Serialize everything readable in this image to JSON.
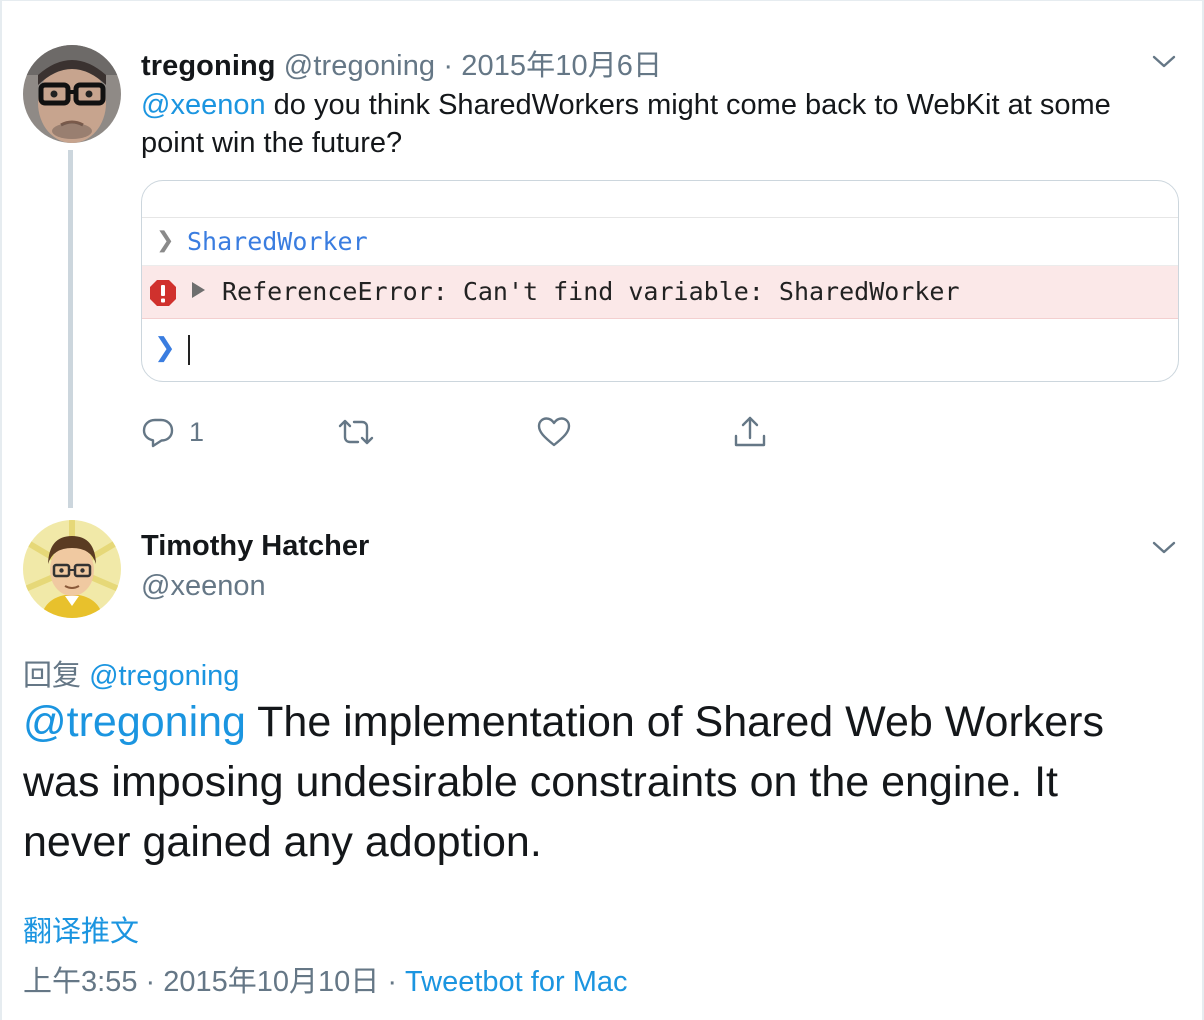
{
  "parent_tweet": {
    "display_name": "tregoning",
    "handle": "@tregoning",
    "separator": " · ",
    "date": "2015年10月6日",
    "mention": "@xeenon",
    "text": " do you think SharedWorkers might come back to WebKit at some point win the future?",
    "console": {
      "input_line": "SharedWorker",
      "error_line": "ReferenceError: Can't find variable: SharedWorker"
    },
    "reply_count": "1"
  },
  "main_tweet": {
    "display_name": "Timothy Hatcher",
    "handle": "@xeenon",
    "replying_prefix": "回复 ",
    "replying_to": "@tregoning",
    "mention": "@tregoning",
    "text": " The implementation of Shared Web Workers was imposing undesirable constraints on the engine. It never gained any adoption.",
    "translate_label": "翻译推文",
    "time": "上午3:55",
    "separator1": " · ",
    "date": "2015年10月10日",
    "separator2": " · ",
    "source": "Tweetbot for Mac"
  },
  "icons": {
    "reply": "reply-icon",
    "retweet": "retweet-icon",
    "like": "heart-icon",
    "share": "share-icon",
    "more": "chevron-down-icon",
    "error": "error-icon"
  },
  "colors": {
    "link": "#1b95e0",
    "muted": "#657786",
    "text": "#14171a",
    "console_error_bg": "#fbe8e8",
    "console_input": "#3a7de0"
  }
}
